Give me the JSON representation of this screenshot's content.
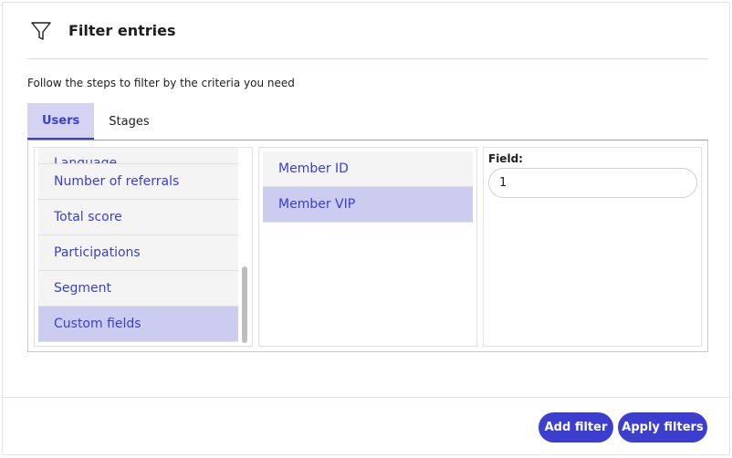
{
  "header": {
    "title": "Filter entries",
    "icon": "filter-icon"
  },
  "subtitle": "Follow the steps to filter by the criteria you need",
  "tabs": [
    {
      "label": "Users",
      "active": true
    },
    {
      "label": "Stages",
      "active": false
    }
  ],
  "criteria": {
    "items": [
      {
        "label": "Language"
      },
      {
        "label": "Number of referrals"
      },
      {
        "label": "Total score"
      },
      {
        "label": "Participations"
      },
      {
        "label": "Segment"
      },
      {
        "label": "Custom fields",
        "selected": true
      }
    ]
  },
  "fields": {
    "items": [
      {
        "label": "Member ID"
      },
      {
        "label": "Member VIP",
        "selected": true
      }
    ]
  },
  "value_panel": {
    "field_label": "Field:",
    "field_value": "1"
  },
  "footer": {
    "add_filter": "Add filter",
    "apply_filters": "Apply filters"
  },
  "colors": {
    "accent": "#3b3ecf",
    "selected_bg": "#ccccf1",
    "tab_active_bg": "#d4d4f2"
  }
}
